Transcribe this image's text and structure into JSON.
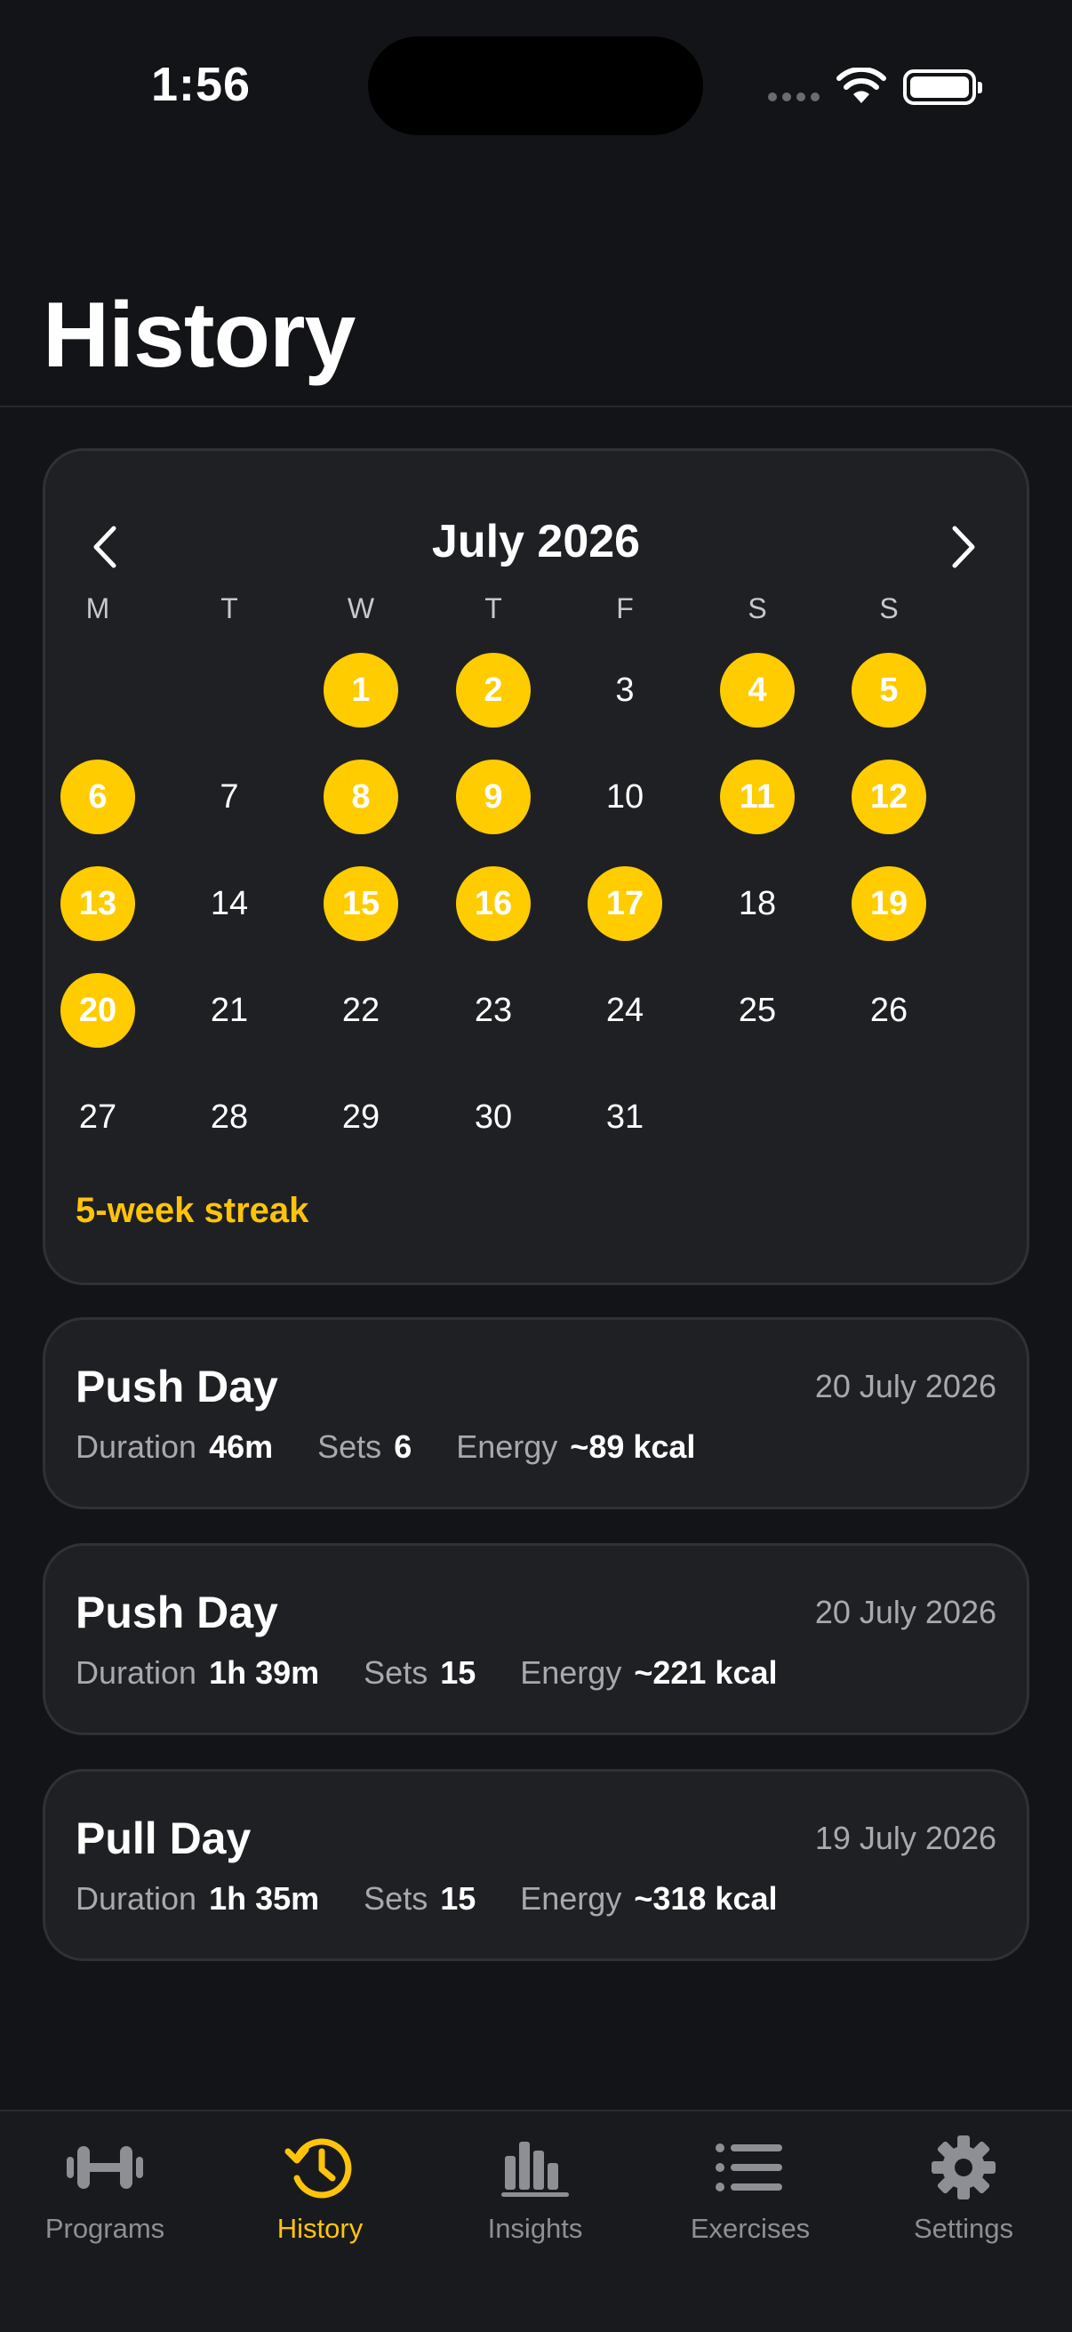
{
  "status_bar": {
    "time": "1:56"
  },
  "page_title": "History",
  "calendar": {
    "month_label": "July 2026",
    "weekdays": [
      "M",
      "T",
      "W",
      "T",
      "F",
      "S",
      "S"
    ],
    "days": [
      {
        "d": "1",
        "done": true
      },
      {
        "d": "2",
        "done": true
      },
      {
        "d": "3",
        "done": false
      },
      {
        "d": "4",
        "done": true
      },
      {
        "d": "5",
        "done": true
      },
      {
        "d": "6",
        "done": true
      },
      {
        "d": "7",
        "done": false
      },
      {
        "d": "8",
        "done": true
      },
      {
        "d": "9",
        "done": true
      },
      {
        "d": "10",
        "done": false
      },
      {
        "d": "11",
        "done": true
      },
      {
        "d": "12",
        "done": true
      },
      {
        "d": "13",
        "done": true
      },
      {
        "d": "14",
        "done": false
      },
      {
        "d": "15",
        "done": true
      },
      {
        "d": "16",
        "done": true
      },
      {
        "d": "17",
        "done": true
      },
      {
        "d": "18",
        "done": false
      },
      {
        "d": "19",
        "done": true
      },
      {
        "d": "20",
        "done": true
      },
      {
        "d": "21",
        "done": false
      },
      {
        "d": "22",
        "done": false
      },
      {
        "d": "23",
        "done": false
      },
      {
        "d": "24",
        "done": false
      },
      {
        "d": "25",
        "done": false
      },
      {
        "d": "26",
        "done": false
      },
      {
        "d": "27",
        "done": false
      },
      {
        "d": "28",
        "done": false
      },
      {
        "d": "29",
        "done": false
      },
      {
        "d": "30",
        "done": false
      },
      {
        "d": "31",
        "done": false
      }
    ],
    "streak_text": "5-week streak"
  },
  "workouts": [
    {
      "name": "Push Day",
      "date": "20 July 2026",
      "stats": [
        {
          "label": "Duration",
          "value": "46m"
        },
        {
          "label": "Sets",
          "value": "6"
        },
        {
          "label": "Energy",
          "value": "~89 kcal"
        }
      ]
    },
    {
      "name": "Push Day",
      "date": "20 July 2026",
      "stats": [
        {
          "label": "Duration",
          "value": "1h 39m"
        },
        {
          "label": "Sets",
          "value": "15"
        },
        {
          "label": "Energy",
          "value": "~221 kcal"
        }
      ]
    },
    {
      "name": "Pull Day",
      "date": "19 July 2026",
      "stats": [
        {
          "label": "Duration",
          "value": "1h 35m"
        },
        {
          "label": "Sets",
          "value": "15"
        },
        {
          "label": "Energy",
          "value": "~318 kcal"
        }
      ]
    }
  ],
  "tabs": [
    {
      "label": "Programs",
      "icon": "dumbbell-icon",
      "active": false
    },
    {
      "label": "History",
      "icon": "history-clock-icon",
      "active": true
    },
    {
      "label": "Insights",
      "icon": "bar-chart-icon",
      "active": false
    },
    {
      "label": "Exercises",
      "icon": "list-icon",
      "active": false
    },
    {
      "label": "Settings",
      "icon": "gear-icon",
      "active": false
    }
  ],
  "colors": {
    "accent": "#ffcc00",
    "background": "#131417",
    "card": "#1f2024",
    "muted_text": "#a8a9ae"
  }
}
